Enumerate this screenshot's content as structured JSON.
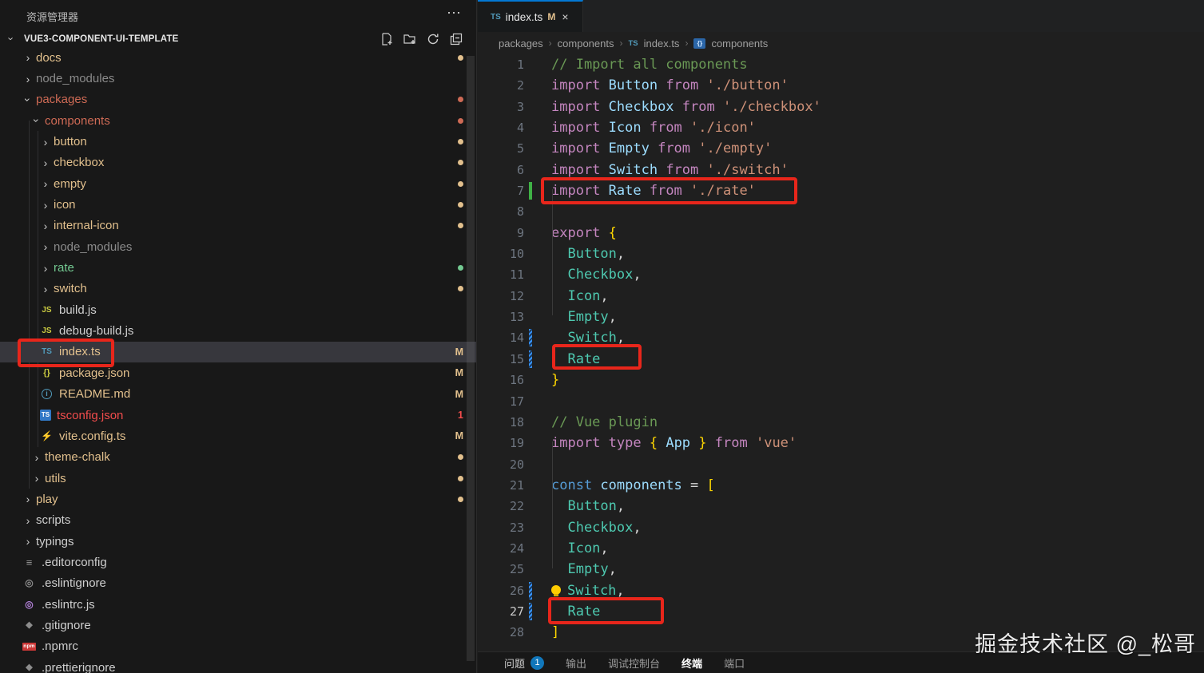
{
  "explorer": {
    "title": "资源管理器",
    "more_icon": "⋯",
    "project": "VUE3-COMPONENT-UI-TEMPLATE",
    "tree": [
      {
        "label": "docs",
        "lvl": 1,
        "kind": "dir",
        "color": "mod",
        "dot": "mod"
      },
      {
        "label": "node_modules",
        "lvl": 1,
        "kind": "dir",
        "color": "ign"
      },
      {
        "label": "packages",
        "lvl": 1,
        "kind": "dir",
        "color": "folderErr",
        "dot": "folderErr",
        "open": true
      },
      {
        "label": "components",
        "lvl": 2,
        "kind": "dir",
        "color": "folderErr",
        "dot": "folderErr",
        "open": true
      },
      {
        "label": "button",
        "lvl": 3,
        "kind": "dir",
        "color": "mod",
        "dot": "mod"
      },
      {
        "label": "checkbox",
        "lvl": 3,
        "kind": "dir",
        "color": "mod",
        "dot": "mod"
      },
      {
        "label": "empty",
        "lvl": 3,
        "kind": "dir",
        "color": "mod",
        "dot": "mod"
      },
      {
        "label": "icon",
        "lvl": 3,
        "kind": "dir",
        "color": "mod",
        "dot": "mod"
      },
      {
        "label": "internal-icon",
        "lvl": 3,
        "kind": "dir",
        "color": "mod",
        "dot": "mod"
      },
      {
        "label": "node_modules",
        "lvl": 3,
        "kind": "dir",
        "color": "ign"
      },
      {
        "label": "rate",
        "lvl": 3,
        "kind": "dir",
        "color": "add",
        "dot": "add"
      },
      {
        "label": "switch",
        "lvl": 3,
        "kind": "dir",
        "color": "mod",
        "dot": "mod"
      },
      {
        "label": "build.js",
        "lvl": 3,
        "kind": "file",
        "icon": "js",
        "icontext": "JS",
        "color": "fg"
      },
      {
        "label": "debug-build.js",
        "lvl": 3,
        "kind": "file",
        "icon": "js",
        "icontext": "JS",
        "color": "fg"
      },
      {
        "label": "index.ts",
        "lvl": 3,
        "kind": "file",
        "icon": "ts",
        "icontext": "TS",
        "color": "mod",
        "badge": "M",
        "badgeColor": "mod",
        "selected": true
      },
      {
        "label": "package.json",
        "lvl": 3,
        "kind": "file",
        "icon": "braces",
        "icontext": "{}",
        "color": "mod",
        "badge": "M",
        "badgeColor": "mod"
      },
      {
        "label": "README.md",
        "lvl": 3,
        "kind": "file",
        "icon": "info",
        "icontext": "i",
        "color": "mod",
        "badge": "M",
        "badgeColor": "mod"
      },
      {
        "label": "tsconfig.json",
        "lvl": 3,
        "kind": "file",
        "icon": "tsbox",
        "icontext": "TS",
        "color": "err",
        "badge": "1",
        "badgeColor": "err"
      },
      {
        "label": "vite.config.ts",
        "lvl": 3,
        "kind": "file",
        "icon": "vite",
        "icontext": "⚡",
        "color": "mod",
        "badge": "M",
        "badgeColor": "mod"
      },
      {
        "label": "theme-chalk",
        "lvl": 2,
        "kind": "dir",
        "color": "mod",
        "dot": "mod"
      },
      {
        "label": "utils",
        "lvl": 2,
        "kind": "dir",
        "color": "mod",
        "dot": "mod"
      },
      {
        "label": "play",
        "lvl": 1,
        "kind": "dir",
        "color": "mod",
        "dot": "mod"
      },
      {
        "label": "scripts",
        "lvl": 1,
        "kind": "dir",
        "color": "fg"
      },
      {
        "label": "typings",
        "lvl": 1,
        "kind": "dir",
        "color": "fg"
      },
      {
        "label": ".editorconfig",
        "lvl": 1,
        "kind": "file",
        "icon": "lines",
        "icontext": "≡",
        "color": "fg"
      },
      {
        "label": ".eslintignore",
        "lvl": 1,
        "kind": "file",
        "icon": "ringGray",
        "icontext": "◎",
        "color": "fg"
      },
      {
        "label": ".eslintrc.js",
        "lvl": 1,
        "kind": "file",
        "icon": "ringPurple",
        "icontext": "◎",
        "color": "fg"
      },
      {
        "label": ".gitignore",
        "lvl": 1,
        "kind": "file",
        "icon": "diamond",
        "icontext": "◆",
        "color": "fg"
      },
      {
        "label": ".npmrc",
        "lvl": 1,
        "kind": "file",
        "icon": "npm",
        "icontext": "npm",
        "color": "fg"
      },
      {
        "label": ".prettierignore",
        "lvl": 1,
        "kind": "file",
        "icon": "diamond",
        "icontext": "◆",
        "color": "fg"
      }
    ]
  },
  "colors": {
    "fg": "#cfcfcf",
    "mod": "#e2c08d",
    "err": "#f14c4c",
    "folderErr": "#ce6a55",
    "add": "#73c991",
    "ign": "#8b8b8b"
  },
  "editor": {
    "tab": {
      "icon": "TS",
      "title": "index.ts",
      "modified": "M",
      "close": "×"
    },
    "breadcrumb": {
      "b0": "packages",
      "b1": "components",
      "b2": "index.ts",
      "b3": "components",
      "ts_icon": "TS",
      "ns_icon": "{}",
      "sep": "›"
    },
    "lines": [
      {
        "n": 1,
        "t": [
          [
            "// Import all components",
            "cm"
          ]
        ]
      },
      {
        "n": 2,
        "t": [
          [
            "import ",
            "kw"
          ],
          [
            "Button ",
            "cl"
          ],
          [
            "from ",
            "kw"
          ],
          [
            "'./button'",
            "st"
          ]
        ]
      },
      {
        "n": 3,
        "t": [
          [
            "import ",
            "kw"
          ],
          [
            "Checkbox ",
            "cl"
          ],
          [
            "from ",
            "kw"
          ],
          [
            "'./checkbox'",
            "st"
          ]
        ]
      },
      {
        "n": 4,
        "t": [
          [
            "import ",
            "kw"
          ],
          [
            "Icon ",
            "cl"
          ],
          [
            "from ",
            "kw"
          ],
          [
            "'./icon'",
            "st"
          ]
        ]
      },
      {
        "n": 5,
        "t": [
          [
            "import ",
            "kw"
          ],
          [
            "Empty ",
            "cl"
          ],
          [
            "from ",
            "kw"
          ],
          [
            "'./empty'",
            "st"
          ]
        ]
      },
      {
        "n": 6,
        "t": [
          [
            "import ",
            "kw"
          ],
          [
            "Switch ",
            "cl"
          ],
          [
            "from ",
            "kw"
          ],
          [
            "'./switch'",
            "st"
          ]
        ]
      },
      {
        "n": 7,
        "g": "add",
        "t": [
          [
            "import ",
            "kw"
          ],
          [
            "Rate ",
            "cl"
          ],
          [
            "from ",
            "kw"
          ],
          [
            "'./rate'",
            "st"
          ]
        ]
      },
      {
        "n": 8,
        "t": []
      },
      {
        "n": 9,
        "t": [
          [
            "export ",
            "kw"
          ],
          [
            "{",
            "br"
          ]
        ]
      },
      {
        "n": 10,
        "t": [
          [
            "  Button",
            "tl"
          ],
          [
            ",",
            "pu"
          ]
        ]
      },
      {
        "n": 11,
        "t": [
          [
            "  Checkbox",
            "tl"
          ],
          [
            ",",
            "pu"
          ]
        ]
      },
      {
        "n": 12,
        "t": [
          [
            "  Icon",
            "tl"
          ],
          [
            ",",
            "pu"
          ]
        ]
      },
      {
        "n": 13,
        "t": [
          [
            "  Empty",
            "tl"
          ],
          [
            ",",
            "pu"
          ]
        ]
      },
      {
        "n": 14,
        "g": "mod",
        "t": [
          [
            "  Switch",
            "tl"
          ],
          [
            ",",
            "pu"
          ]
        ]
      },
      {
        "n": 15,
        "g": "mod",
        "t": [
          [
            "  Rate",
            "tl"
          ]
        ]
      },
      {
        "n": 16,
        "t": [
          [
            "}",
            "br"
          ]
        ]
      },
      {
        "n": 17,
        "t": []
      },
      {
        "n": 18,
        "t": [
          [
            "// Vue plugin",
            "cm"
          ]
        ]
      },
      {
        "n": 19,
        "t": [
          [
            "import ",
            "kw"
          ],
          [
            "type ",
            "kw"
          ],
          [
            "{ ",
            "br"
          ],
          [
            "App",
            "cl"
          ],
          [
            " ",
            "pu"
          ],
          [
            "} ",
            "br"
          ],
          [
            "from ",
            "kw"
          ],
          [
            "'vue'",
            "st"
          ]
        ]
      },
      {
        "n": 20,
        "t": []
      },
      {
        "n": 21,
        "t": [
          [
            "const ",
            "kb"
          ],
          [
            "components ",
            "cl"
          ],
          [
            "= ",
            "pu"
          ],
          [
            "[",
            "br"
          ]
        ]
      },
      {
        "n": 22,
        "t": [
          [
            "  Button",
            "tl"
          ],
          [
            ",",
            "pu"
          ]
        ]
      },
      {
        "n": 23,
        "t": [
          [
            "  Checkbox",
            "tl"
          ],
          [
            ",",
            "pu"
          ]
        ]
      },
      {
        "n": 24,
        "t": [
          [
            "  Icon",
            "tl"
          ],
          [
            ",",
            "pu"
          ]
        ]
      },
      {
        "n": 25,
        "t": [
          [
            "  Empty",
            "tl"
          ],
          [
            ",",
            "pu"
          ]
        ]
      },
      {
        "n": 26,
        "g": "mod",
        "bulb": true,
        "t": [
          [
            "Switch",
            "tl"
          ],
          [
            ",",
            "pu"
          ]
        ]
      },
      {
        "n": 27,
        "g": "mod",
        "active": true,
        "t": [
          [
            "  Rate",
            "tl"
          ]
        ]
      },
      {
        "n": 28,
        "t": [
          [
            "]",
            "br"
          ]
        ]
      }
    ]
  },
  "panel": {
    "tabs": [
      {
        "label": "问题",
        "badge": "1",
        "tone": "bright"
      },
      {
        "label": "输出"
      },
      {
        "label": "调试控制台"
      },
      {
        "label": "终端",
        "active": true
      },
      {
        "label": "端口"
      }
    ]
  },
  "watermark": "掘金技术社区 @_松哥"
}
